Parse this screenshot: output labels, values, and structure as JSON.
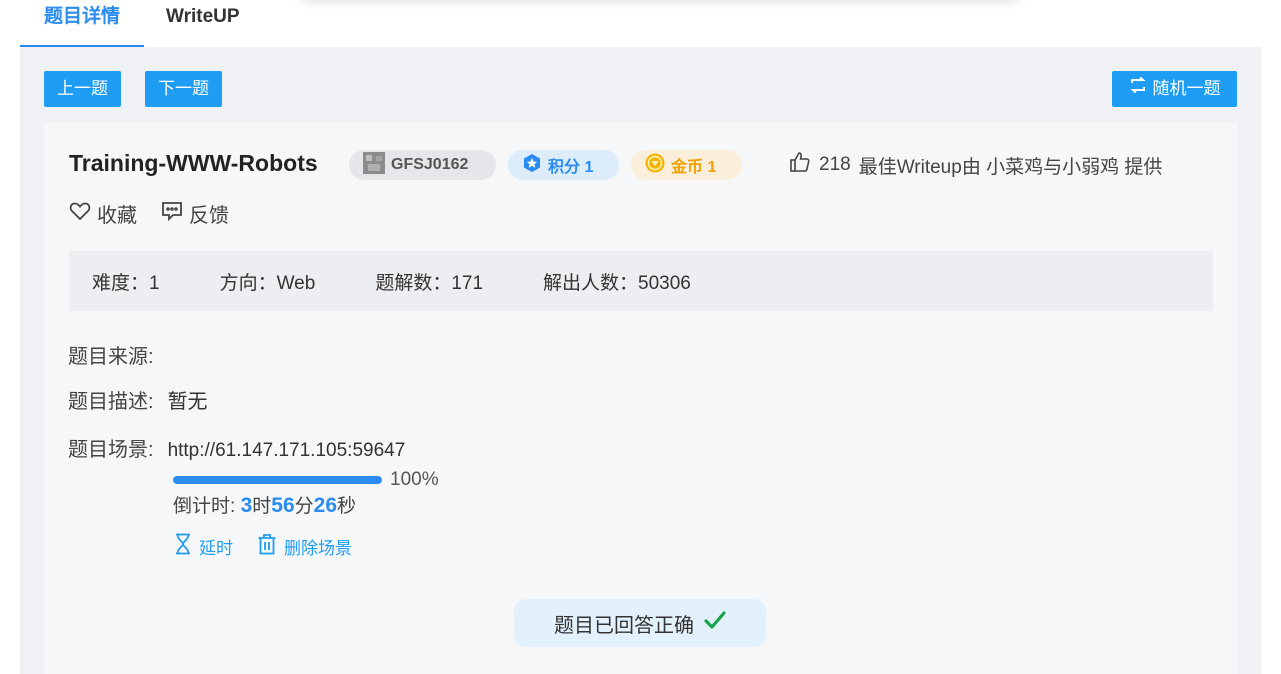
{
  "tabs": [
    {
      "label": "题目详情",
      "active": true
    },
    {
      "label": "WriteUP",
      "active": false
    }
  ],
  "nav": {
    "prev_label": "上一题",
    "next_label": "下一题",
    "random_label": "随机一题"
  },
  "challenge": {
    "title": "Training-WWW-Robots",
    "id": "GFSJ0162",
    "score_label": "积分 1",
    "coin_label": "金币 1",
    "likes": "218",
    "best_writeup": "最佳Writeup由 小菜鸡与小弱鸡 提供",
    "favorite_label": "收藏",
    "feedback_label": "反馈"
  },
  "stats": {
    "difficulty": "难度：1",
    "direction": "方向：Web",
    "solutions": "题解数：171",
    "solvers": "解出人数：50306"
  },
  "details": {
    "source_label": "题目来源:",
    "source_value": "",
    "desc_label": "题目描述:",
    "desc_value": "暂无",
    "scene_label": "题目场景:",
    "scene_url": "http://61.147.171.105:59647",
    "progress": 1.0,
    "progress_text": "100%",
    "countdown_prefix": "倒计时: ",
    "hours": "3",
    "hours_unit": "时",
    "minutes": "56",
    "minutes_unit": "分",
    "seconds": "26",
    "seconds_unit": "秒",
    "extend_label": "延时",
    "delete_label": "删除场景"
  },
  "status": {
    "answered_label": "题目已回答正确"
  },
  "colors": {
    "accent": "#2a8cf0",
    "button": "#1f9df5",
    "success": "#19a64a",
    "coin": "#f0a000"
  },
  "icons": {
    "random": "refresh-icon",
    "id_badge": "avatar-icon",
    "score": "star-icon",
    "coin": "coin-icon",
    "likes": "thumbs-up-icon",
    "favorite": "heart-icon",
    "feedback": "message-icon",
    "extend": "hourglass-icon",
    "delete": "trash-icon",
    "answered": "check-icon"
  }
}
